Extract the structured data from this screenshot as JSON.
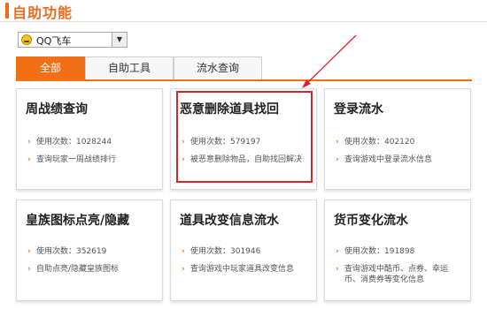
{
  "page": {
    "title": "自助功能"
  },
  "game_select": {
    "value": "QQ飞车",
    "dropdown_glyph": "▼"
  },
  "tabs": [
    {
      "label": "全部",
      "active": true
    },
    {
      "label": "自助工具",
      "active": false
    },
    {
      "label": "流水查询",
      "active": false
    }
  ],
  "cards": [
    {
      "title": "周战绩查询",
      "lines": [
        "使用次数：1028244",
        "查询玩家一周战绩排行"
      ]
    },
    {
      "title": "恶意删除道具找回",
      "lines": [
        "使用次数：579197",
        "被恶意删除物品，自助找回解决"
      ]
    },
    {
      "title": "登录流水",
      "lines": [
        "使用次数：402120",
        "查询游戏中登录流水信息"
      ]
    },
    {
      "title": "皇族图标点亮/隐藏",
      "lines": [
        "使用次数：352619",
        "自助点亮/隐藏皇族图标"
      ]
    },
    {
      "title": "道具改变信息流水",
      "lines": [
        "使用次数：301946",
        "查询游戏中玩家道具改变信息"
      ]
    },
    {
      "title": "货币变化流水",
      "lines": [
        "使用次数：191898",
        "查询游戏中酷币、点券、幸运",
        "币、消费券等变化信息"
      ]
    }
  ],
  "colors": {
    "accent": "#f27015",
    "highlight": "#d9242a"
  },
  "icons": {
    "bullet": "›"
  }
}
